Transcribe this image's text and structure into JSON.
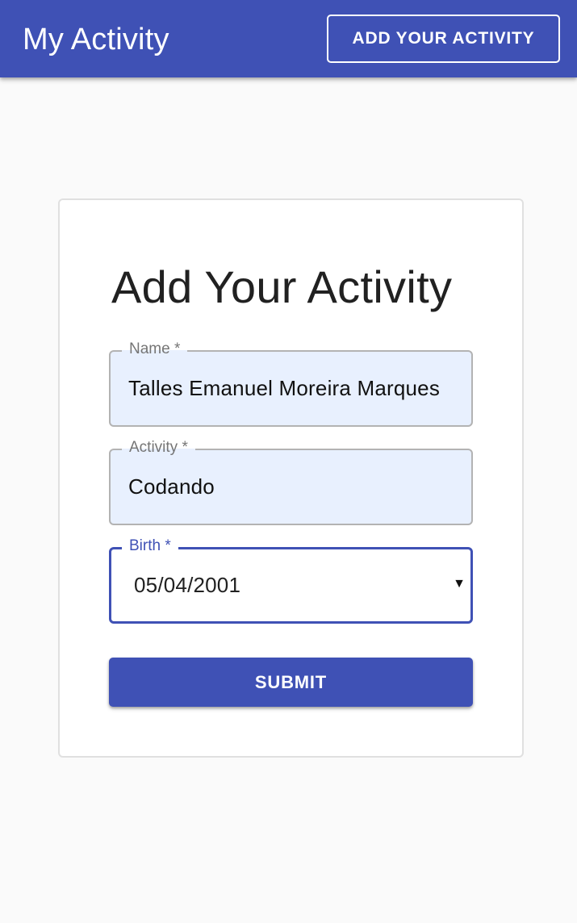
{
  "header": {
    "title": "My Activity",
    "action_button_label": "ADD YOUR ACTIVITY"
  },
  "form": {
    "title": "Add Your Activity",
    "fields": [
      {
        "label": "Name *",
        "value": "Talles Emanuel Moreira Marques"
      },
      {
        "label": "Activity *",
        "value": "Codando"
      },
      {
        "label": "Birth *",
        "value": "05/04/2001"
      }
    ],
    "submit_label": "SUBMIT"
  },
  "icons": {
    "date_picker": "dropdown-arrow-icon"
  },
  "colors": {
    "primary": "#3f51b5",
    "background": "#fafafa",
    "autofill": "#e8f0fe"
  }
}
